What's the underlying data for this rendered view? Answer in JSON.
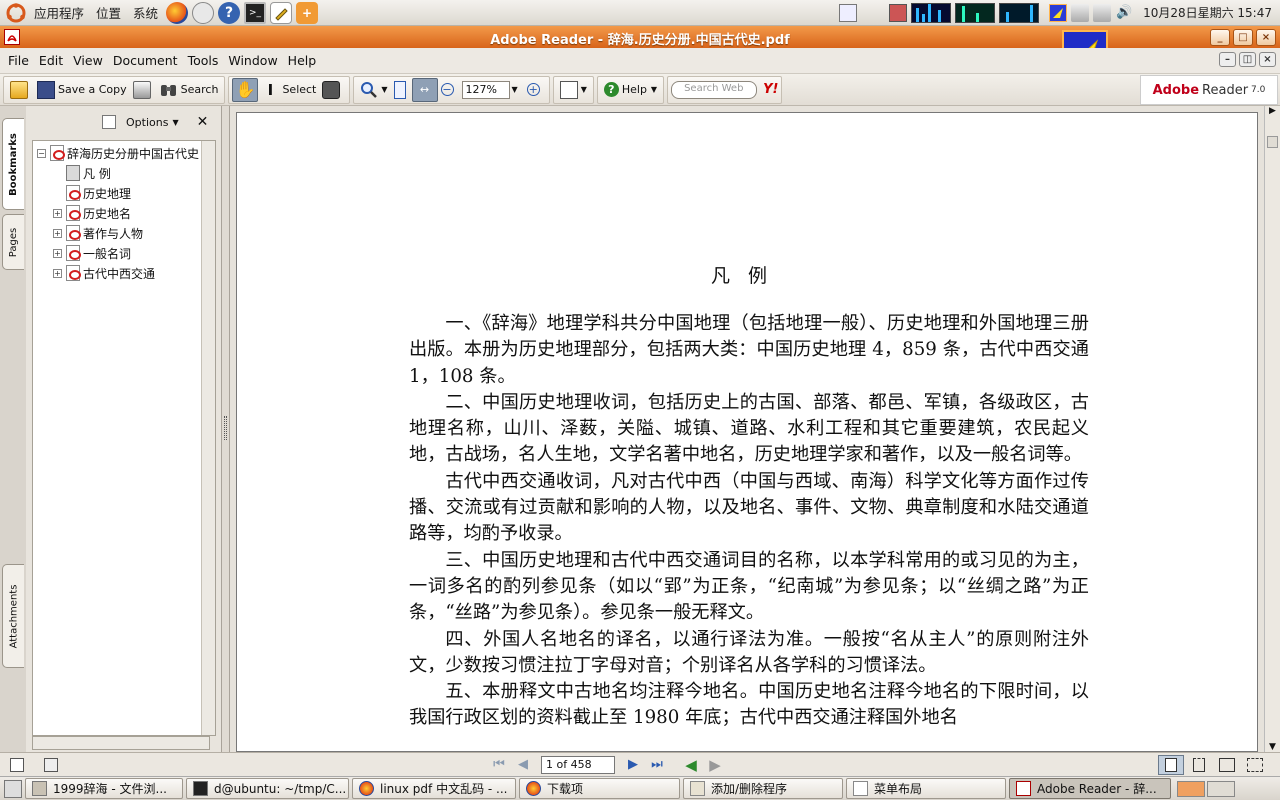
{
  "top_panel": {
    "menus": [
      "应用程序",
      "位置",
      "系统"
    ],
    "clock": "10月28日星期六 15:47"
  },
  "window": {
    "title": "Adobe Reader - 辞海.历史分册.中国古代史.pdf"
  },
  "menubar": {
    "items": [
      "File",
      "Edit",
      "View",
      "Document",
      "Tools",
      "Window",
      "Help"
    ],
    "mnemonics": [
      "F",
      "E",
      "V",
      "D",
      "T",
      "W",
      "H"
    ]
  },
  "toolbar": {
    "save_copy_label": "Save a Copy",
    "search_label": "Search",
    "select_label": "Select",
    "zoom_value": "127%",
    "help_label": "Help",
    "search_web_placeholder": "Search Web",
    "yahoo_label": "Y!"
  },
  "adobe_logo": {
    "brand": "Adobe",
    "product": "Reader",
    "version": "7.0"
  },
  "side_tabs": {
    "bookmarks": "Bookmarks",
    "pages": "Pages",
    "attachments": "Attachments"
  },
  "bookmarks_panel": {
    "options_label": "Options",
    "tree": [
      {
        "label": "辞海历史分册中国古代史",
        "level": 0,
        "expander": "−",
        "icon": "pdf-icon"
      },
      {
        "label": "凡 例",
        "level": 1,
        "expander": "",
        "icon": "page-icon"
      },
      {
        "label": "历史地理",
        "level": 1,
        "expander": "",
        "icon": "pdf-icon"
      },
      {
        "label": "历史地名",
        "level": 1,
        "expander": "+",
        "icon": "pdf-icon"
      },
      {
        "label": "著作与人物",
        "level": 1,
        "expander": "+",
        "icon": "pdf-icon"
      },
      {
        "label": "一般名词",
        "level": 1,
        "expander": "+",
        "icon": "pdf-icon"
      },
      {
        "label": "古代中西交通",
        "level": 1,
        "expander": "+",
        "icon": "pdf-icon"
      }
    ]
  },
  "document": {
    "heading": "凡例",
    "paragraphs": [
      "一、《辞海》地理学科共分中国地理（包括地理一般）、历史地理和外国地理三册出版。本册为历史地理部分，包括两大类：中国历史地理 4，859 条，古代中西交通 1，108 条。",
      "二、中国历史地理收词，包括历史上的古国、部落、都邑、军镇，各级政区，古地理名称，山川、泽薮，关隘、城镇、道路、水利工程和其它重要建筑，农民起义地，古战场，名人生地，文学名著中地名，历史地理学家和著作，以及一般名词等。",
      "古代中西交通收词，凡对古代中西（中国与西域、南海）科学文化等方面作过传播、交流或有过贡献和影响的人物，以及地名、事件、文物、典章制度和水陆交通道路等，均酌予收录。",
      "三、中国历史地理和古代中西交通词目的名称，以本学科常用的或习见的为主，一词多名的酌列参见条（如以“郢”为正条，“纪南城”为参见条；以“丝绸之路”为正条，“丝路”为参见条）。参见条一般无释文。",
      "四、外国人名地名的译名，以通行译法为准。一般按“名从主人”的原则附注外文，少数按习惯注拉丁字母对音；个别译名从各学科的习惯译法。",
      "五、本册释文中古地名均注释今地名。中国历史地名注释今地名的下限时间，以我国行政区划的资料截止至 1980 年底；古代中西交通注释国外地名"
    ]
  },
  "statusbar": {
    "page_indicator": "1 of 458"
  },
  "taskbar": {
    "tasks": [
      {
        "label": "1999辞海 - 文件浏...",
        "icon": "folder-icon"
      },
      {
        "label": "d@ubuntu: ~/tmp/C...",
        "icon": "terminal-icon"
      },
      {
        "label": "linux pdf 中文乱码 - ...",
        "icon": "firefox-icon"
      },
      {
        "label": "下载项",
        "icon": "firefox-icon"
      },
      {
        "label": "添加/删除程序",
        "icon": "package-icon"
      },
      {
        "label": "菜单布局",
        "icon": "menu-icon"
      },
      {
        "label": "Adobe Reader - 辞...",
        "icon": "acrobat-icon"
      }
    ]
  },
  "colors": {
    "titlebar": "#e07a2c",
    "accent_orange": "#f39a4a",
    "adobe_red": "#c0001a"
  }
}
